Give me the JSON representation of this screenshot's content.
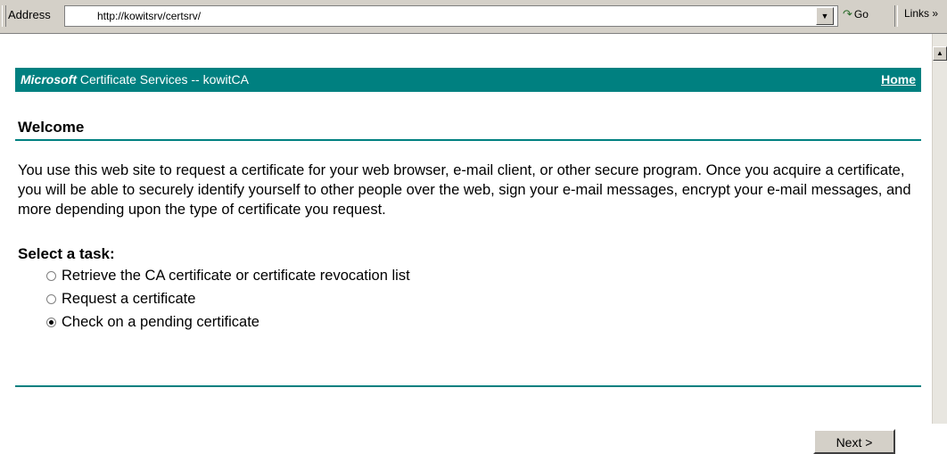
{
  "toolbar": {
    "address_label": "Address",
    "url": "http://kowitsrv/certsrv/",
    "go_label": "Go",
    "links_label": "Links",
    "links_chevron": "»"
  },
  "banner": {
    "brand": "Microsoft",
    "title": " Certificate Services  --  kowitCA",
    "home_link": "Home"
  },
  "page": {
    "heading": "Welcome",
    "paragraph": "You use this web site to request a certificate for your web browser, e-mail client, or other secure program. Once you acquire a certificate, you will be able to securely identify yourself to other people over the web, sign your e-mail messages, encrypt your e-mail messages, and more depending upon the type of certificate you request.",
    "task_label": "Select a task:",
    "options": [
      {
        "label": "Retrieve the CA certificate or certificate revocation list",
        "checked": false
      },
      {
        "label": "Request a certificate",
        "checked": false
      },
      {
        "label": "Check on a pending certificate",
        "checked": true
      }
    ],
    "next_button": "Next >"
  },
  "colors": {
    "accent": "#008080",
    "chrome": "#d4d0c8"
  }
}
